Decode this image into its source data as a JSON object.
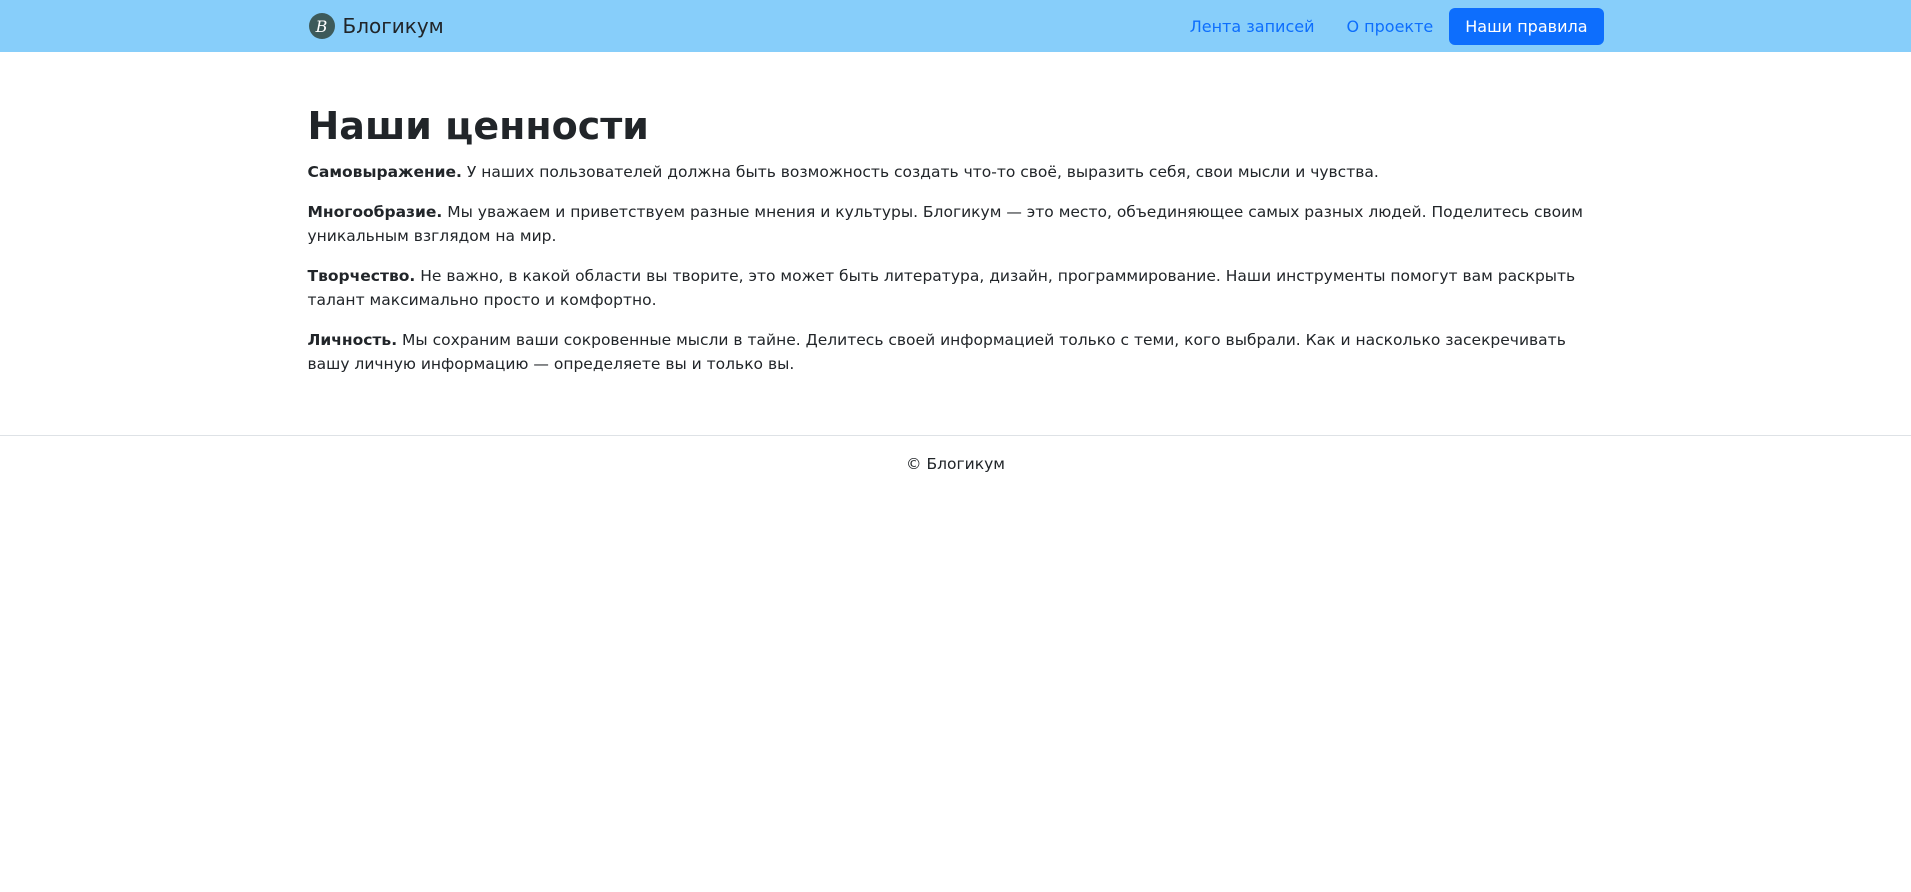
{
  "header": {
    "brand_logo_letter": "B",
    "brand_name": "Блогикум",
    "nav": [
      {
        "label": "Лента записей"
      },
      {
        "label": "О проекте"
      },
      {
        "label": "Наши правила"
      }
    ]
  },
  "main": {
    "title": "Наши ценности",
    "values": [
      {
        "term": "Самовыражение.",
        "text": " У наших пользователей должна быть возможность создать что-то своё, выразить себя, свои мысли и чувства."
      },
      {
        "term": "Многообразие.",
        "text": " Мы уважаем и приветствуем разные мнения и культуры. Блогикум — это место, объединяющее самых разных людей. Поделитесь своим уникальным взглядом на мир."
      },
      {
        "term": "Творчество.",
        "text": " Не важно, в какой области вы творите, это может быть литература, дизайн, программирование. Наши инструменты помогут вам раскрыть талант максимально просто и комфортно."
      },
      {
        "term": "Личность.",
        "text": " Мы сохраним ваши сокровенные мысли в тайне. Делитесь своей информацией только с теми, кого выбрали. Как и насколько засекречивать вашу личную информацию — определяете вы и только вы."
      }
    ]
  },
  "footer": {
    "copyright": "© Блогикум"
  },
  "colors": {
    "navbar_bg": "#87cefa",
    "link": "#0d6efd",
    "active_button": "#0d6efd"
  }
}
